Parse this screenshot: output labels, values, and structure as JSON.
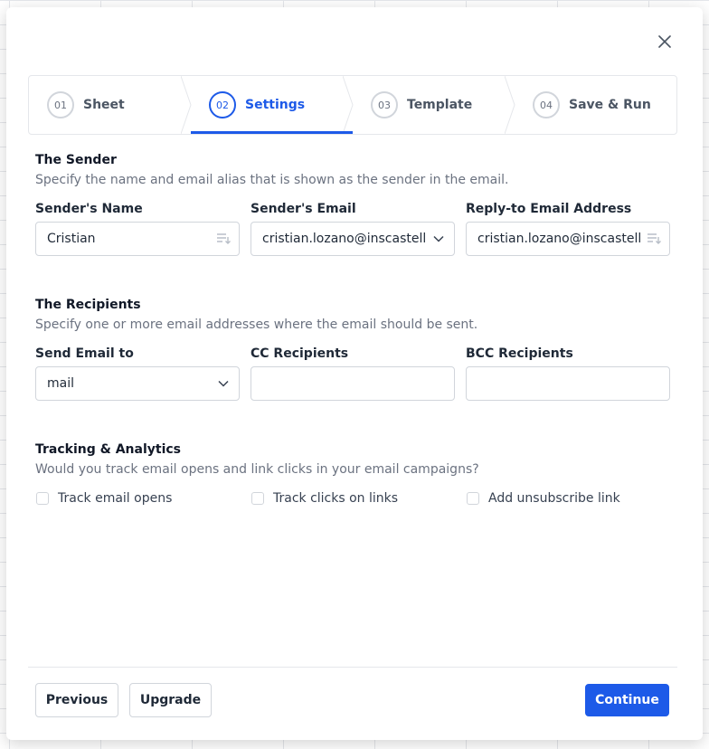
{
  "steps": [
    {
      "num": "01",
      "label": "Sheet"
    },
    {
      "num": "02",
      "label": "Settings"
    },
    {
      "num": "03",
      "label": "Template"
    },
    {
      "num": "04",
      "label": "Save & Run"
    }
  ],
  "sender": {
    "title": "The Sender",
    "description": "Specify the name and email alias that is shown as the sender in the email.",
    "name_label": "Sender's Name",
    "name_value": "Cristian",
    "email_label": "Sender's Email",
    "email_value": "cristian.lozano@inscastellbisbal.cat",
    "reply_label": "Reply-to Email Address",
    "reply_value": "cristian.lozano@inscastellbisbal.cat"
  },
  "recipients": {
    "title": "The Recipients",
    "description": "Specify one or more email addresses where the email should be sent.",
    "to_label": "Send Email to",
    "to_value": "mail",
    "cc_label": "CC Recipients",
    "cc_value": "",
    "bcc_label": "BCC Recipients",
    "bcc_value": ""
  },
  "tracking": {
    "title": "Tracking & Analytics",
    "description": "Would you track email opens and link clicks in your email campaigns?",
    "opens_label": "Track email opens",
    "clicks_label": "Track clicks on links",
    "unsubscribe_label": "Add unsubscribe link"
  },
  "footer": {
    "previous_label": "Previous",
    "upgrade_label": "Upgrade",
    "continue_label": "Continue"
  },
  "colors": {
    "accent": "#1d5ae8"
  }
}
